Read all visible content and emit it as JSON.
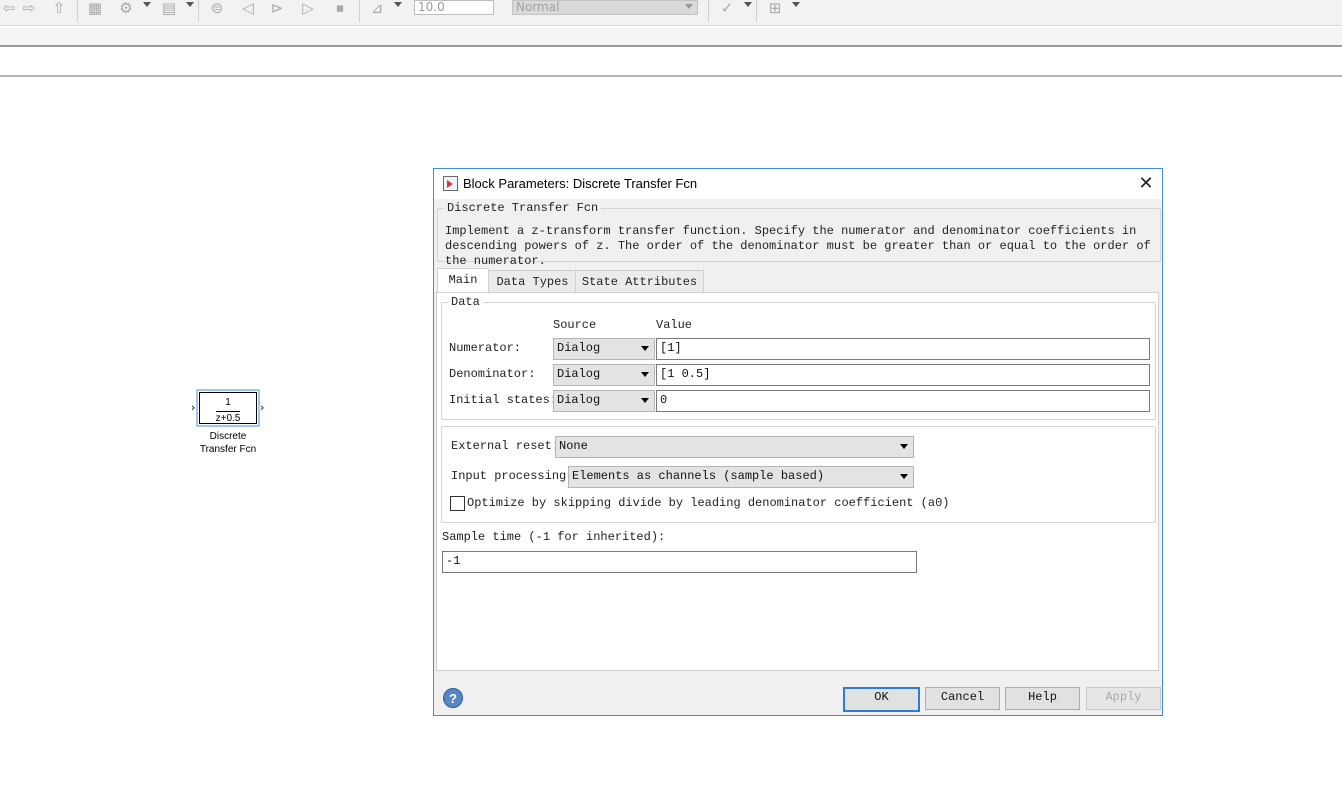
{
  "toolbar": {
    "stop_time": "10.0",
    "sim_mode": "Normal",
    "icons": [
      "redo-icon",
      "up-icon",
      "library-icon",
      "settings-icon",
      "model-explorer-icon",
      "step-back-icon",
      "run-icon",
      "step-forward-icon",
      "stop-icon",
      "scope-icon",
      "check-icon",
      "grid-icon"
    ]
  },
  "canvas": {
    "block": {
      "numerator": "1",
      "denominator": "z+0.5",
      "label_line1": "Discrete",
      "label_line2": "Transfer Fcn",
      "in_port": "›",
      "out_port": "›"
    }
  },
  "dialog": {
    "title": "Block Parameters: Discrete Transfer Fcn",
    "close": "✕",
    "group_title": "Discrete Transfer Fcn",
    "description": "Implement a z-transform transfer function. Specify the numerator and denominator coefficients in descending powers of z. The order of the denominator must be greater than or equal to the order of the numerator.",
    "tabs": [
      "Main",
      "Data Types",
      "State Attributes"
    ],
    "data_group": {
      "title": "Data",
      "source_header": "Source",
      "value_header": "Value",
      "rows": [
        {
          "label": "Numerator:",
          "source": "Dialog",
          "value": "[1]"
        },
        {
          "label": "Denominator:",
          "source": "Dialog",
          "value": "[1 0.5]"
        },
        {
          "label": "Initial states:",
          "source": "Dialog",
          "value": "0"
        }
      ]
    },
    "options": {
      "external_reset_label": "External reset:",
      "external_reset_value": "None",
      "input_processing_label": "Input processing:",
      "input_processing_value": "Elements as channels (sample based)",
      "optimize_label": "Optimize by skipping divide by leading denominator coefficient (a0)",
      "optimize_checked": false
    },
    "sample_time_label": "Sample time (-1 for inherited):",
    "sample_time_value": "-1",
    "buttons": {
      "ok": "OK",
      "cancel": "Cancel",
      "help": "Help",
      "apply": "Apply"
    },
    "help_icon": "?"
  },
  "colors": {
    "dialog_border": "#3c8fd8",
    "default_button_border": "#2f7bd6",
    "block_selection": "#9fc6ec"
  }
}
